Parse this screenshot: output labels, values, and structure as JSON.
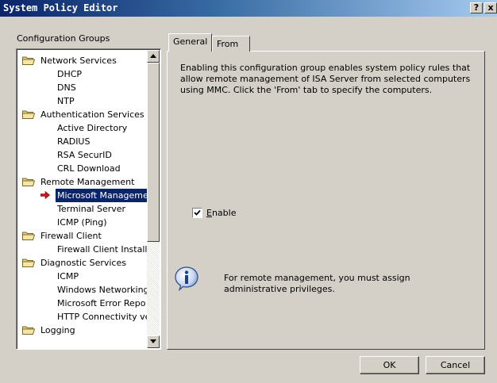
{
  "window": {
    "title": "System Policy Editor",
    "help_button": "?",
    "close_button": "x"
  },
  "groups_label": "Configuration Groups",
  "tree": {
    "items": [
      {
        "label": "Network Services",
        "type": "group"
      },
      {
        "label": "DHCP",
        "type": "leaf"
      },
      {
        "label": "DNS",
        "type": "leaf"
      },
      {
        "label": "NTP",
        "type": "leaf"
      },
      {
        "label": "Authentication Services",
        "type": "group"
      },
      {
        "label": "Active Directory",
        "type": "leaf"
      },
      {
        "label": "RADIUS",
        "type": "leaf"
      },
      {
        "label": "RSA SecurID",
        "type": "leaf"
      },
      {
        "label": "CRL Download",
        "type": "leaf"
      },
      {
        "label": "Remote Management",
        "type": "group"
      },
      {
        "label": "Microsoft Manageme",
        "type": "leaf",
        "selected": true
      },
      {
        "label": "Terminal Server",
        "type": "leaf"
      },
      {
        "label": "ICMP (Ping)",
        "type": "leaf"
      },
      {
        "label": "Firewall Client",
        "type": "group"
      },
      {
        "label": "Firewall Client Install",
        "type": "leaf"
      },
      {
        "label": "Diagnostic Services",
        "type": "group"
      },
      {
        "label": "ICMP",
        "type": "leaf"
      },
      {
        "label": "Windows Networking",
        "type": "leaf"
      },
      {
        "label": "Microsoft Error Repo",
        "type": "leaf"
      },
      {
        "label": "HTTP Connectivity ve",
        "type": "leaf"
      },
      {
        "label": "Logging",
        "type": "group"
      }
    ],
    "group_icon": "folder-icon",
    "selected_icon": "red-arrow-icon"
  },
  "tabs": [
    {
      "label": "General",
      "active": true
    },
    {
      "label": "From",
      "active": false
    }
  ],
  "general": {
    "description": "Enabling this configuration group enables system policy rules that allow remote management of ISA Server from selected computers using MMC. Click the 'From' tab to specify the computers.",
    "enable_checkbox": {
      "label": "Enable",
      "checked": true,
      "accelerator": "E"
    },
    "info_icon": "info-icon",
    "info_text": "For remote management, you must assign administrative privileges."
  },
  "buttons": {
    "ok": "OK",
    "cancel": "Cancel"
  },
  "colors": {
    "title_bar_start": "#0a246a",
    "title_bar_end": "#a6caf0",
    "selection": "#0a246a",
    "dialog_face": "#d4d0c8"
  }
}
